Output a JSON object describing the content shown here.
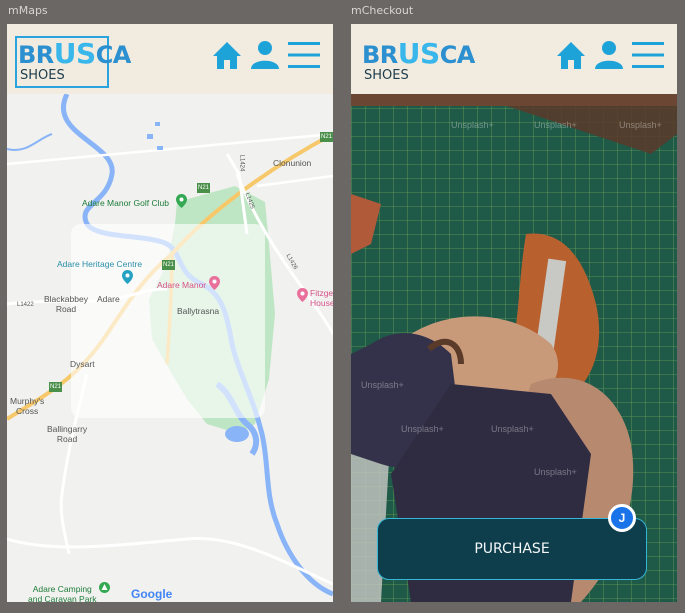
{
  "frames": {
    "left_label": "mMaps",
    "right_label": "mCheckout"
  },
  "brand": {
    "prefix": "BR",
    "highlight": "US",
    "suffix": "CA",
    "subline": "SHOES"
  },
  "icons": {
    "home": "home-icon",
    "user": "user-icon",
    "menu": "hamburger-menu-icon"
  },
  "colors": {
    "header_bg": "#f1ebe0",
    "brand_blue": "#2b8fd0",
    "icon_blue": "#1ea3d9",
    "button_bg": "#0e3e4c",
    "button_border": "#36b5d6"
  },
  "map": {
    "places": {
      "golf": "Adare Manor Golf Club",
      "heritage": "Adare Heritage Centre",
      "manor": "Adare Manor",
      "adare": "Adare",
      "ballytrasna": "Ballytrasna",
      "blackabbey": "Blackabbey\nRoad",
      "dysart": "Dysart",
      "murphys": "Murphy's\nCross",
      "ballingarry": "Ballingarry\nRoad",
      "clonunion": "Clonunion",
      "fitzgerald": "Fitzge\nHouse",
      "camping": "Adare Camping\nand Caravan Park"
    },
    "roads": {
      "n21_a": "N21",
      "n21_b": "N21",
      "n21_c": "N21",
      "l1424": "L1424",
      "l1425": "L1425",
      "l1422": "L1422",
      "l1426": "L1426",
      "n21_d": "N21"
    },
    "attribution": "Google"
  },
  "checkout": {
    "watermark": "Unsplash+",
    "purchase_label": "PURCHASE",
    "avatar_initial": "J"
  }
}
